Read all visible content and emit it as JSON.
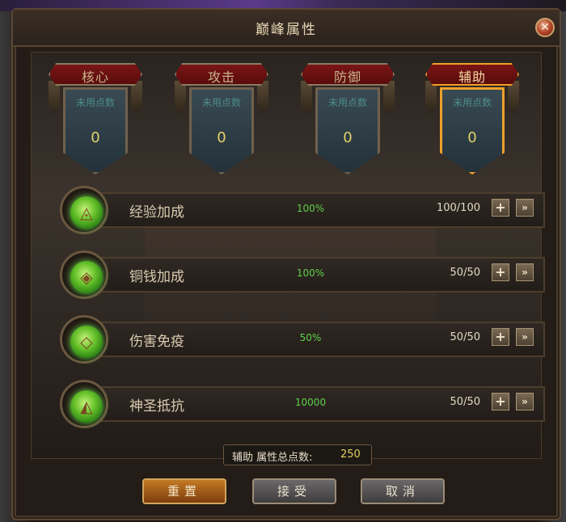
{
  "window": {
    "title": "巅峰属性",
    "close_icon": "close-icon"
  },
  "tabs": [
    {
      "label": "核心",
      "unused_label": "未用点数",
      "unused_value": "0",
      "active": false
    },
    {
      "label": "攻击",
      "unused_label": "未用点数",
      "unused_value": "0",
      "active": false
    },
    {
      "label": "防御",
      "unused_label": "未用点数",
      "unused_value": "0",
      "active": false
    },
    {
      "label": "辅助",
      "unused_label": "未用点数",
      "unused_value": "0",
      "active": true
    }
  ],
  "attributes": [
    {
      "name": "经验加成",
      "value": "100%",
      "count": "100/100",
      "icon": "rune-icon"
    },
    {
      "name": "铜钱加成",
      "value": "100%",
      "count": "50/50",
      "icon": "rune-icon"
    },
    {
      "name": "伤害免疫",
      "value": "50%",
      "count": "50/50",
      "icon": "rune-icon"
    },
    {
      "name": "神圣抵抗",
      "value": "10000",
      "count": "50/50",
      "icon": "rune-icon"
    }
  ],
  "summary": {
    "label": "辅助 属性总点数:",
    "value": "250"
  },
  "buttons": {
    "reset": "重置",
    "accept": "接受",
    "cancel": "取消"
  },
  "colors": {
    "active_tab_border": "#f0a02a",
    "value_green": "#5ed14a",
    "points_yellow": "#e2d06a"
  }
}
